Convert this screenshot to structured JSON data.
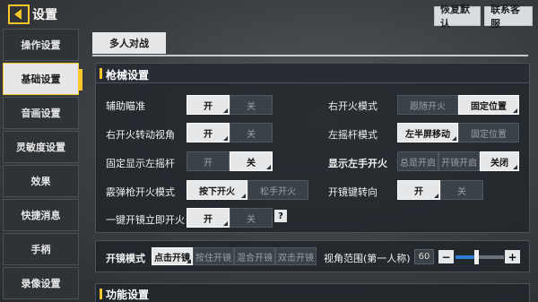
{
  "header": {
    "title": "设置",
    "restore_default": "恢复默认",
    "customer_service": "联系客服"
  },
  "sidebar": {
    "items": [
      {
        "label": "操作设置"
      },
      {
        "label": "基础设置"
      },
      {
        "label": "音画设置"
      },
      {
        "label": "灵敏度设置"
      },
      {
        "label": "效果"
      },
      {
        "label": "快捷消息"
      },
      {
        "label": "手柄"
      },
      {
        "label": "录像设置"
      }
    ],
    "active_index": 1
  },
  "mode_tab": "多人对战",
  "gun_settings": {
    "title": "枪械设置",
    "aim_assist": {
      "label": "辅助瞄准",
      "on": "开",
      "off": "关",
      "selected": "开"
    },
    "right_fire_mode": {
      "label": "右开火模式",
      "opt1": "跟随开火",
      "opt2": "固定位置",
      "selected": "固定位置"
    },
    "right_fire_turn": {
      "label": "右开火转动视角",
      "on": "开",
      "off": "关",
      "selected": "开"
    },
    "left_stick_mode": {
      "label": "左摇杆模式",
      "opt1": "左半屏移动",
      "opt2": "固定位置",
      "selected": "左半屏移动"
    },
    "fixed_left_stick": {
      "label": "固定显示左摇杆",
      "on": "开",
      "off": "关",
      "selected": "关"
    },
    "show_left_fire": {
      "label": "显示左手开火",
      "opt1": "总是开启",
      "opt2": "开镜开启",
      "opt3": "关闭",
      "selected": "关闭"
    },
    "shotgun_fire_mode": {
      "label": "霰弹枪开火模式",
      "opt1": "按下开火",
      "opt2": "松手开火",
      "selected": "按下开火"
    },
    "scope_key_turn": {
      "label": "开镜键转向",
      "on": "开",
      "off": "关",
      "selected": "开"
    },
    "one_key_scope_fire": {
      "label": "一键开镜立即开火",
      "on": "开",
      "off": "关",
      "selected": "开",
      "help": "?"
    }
  },
  "scope": {
    "mode_label": "开镜模式",
    "modes": [
      "点击开镜",
      "按住开镜",
      "混合开镜",
      "双击开镜"
    ],
    "selected": "点击开镜",
    "fov_label": "视角范围(第一人称)",
    "fov_value": "60",
    "fov_level": 0.42,
    "minus": "−",
    "plus": "+"
  },
  "function_settings": {
    "title": "功能设置"
  },
  "colors": {
    "accent": "#f6c62a",
    "slider": "#2f7fd6"
  }
}
